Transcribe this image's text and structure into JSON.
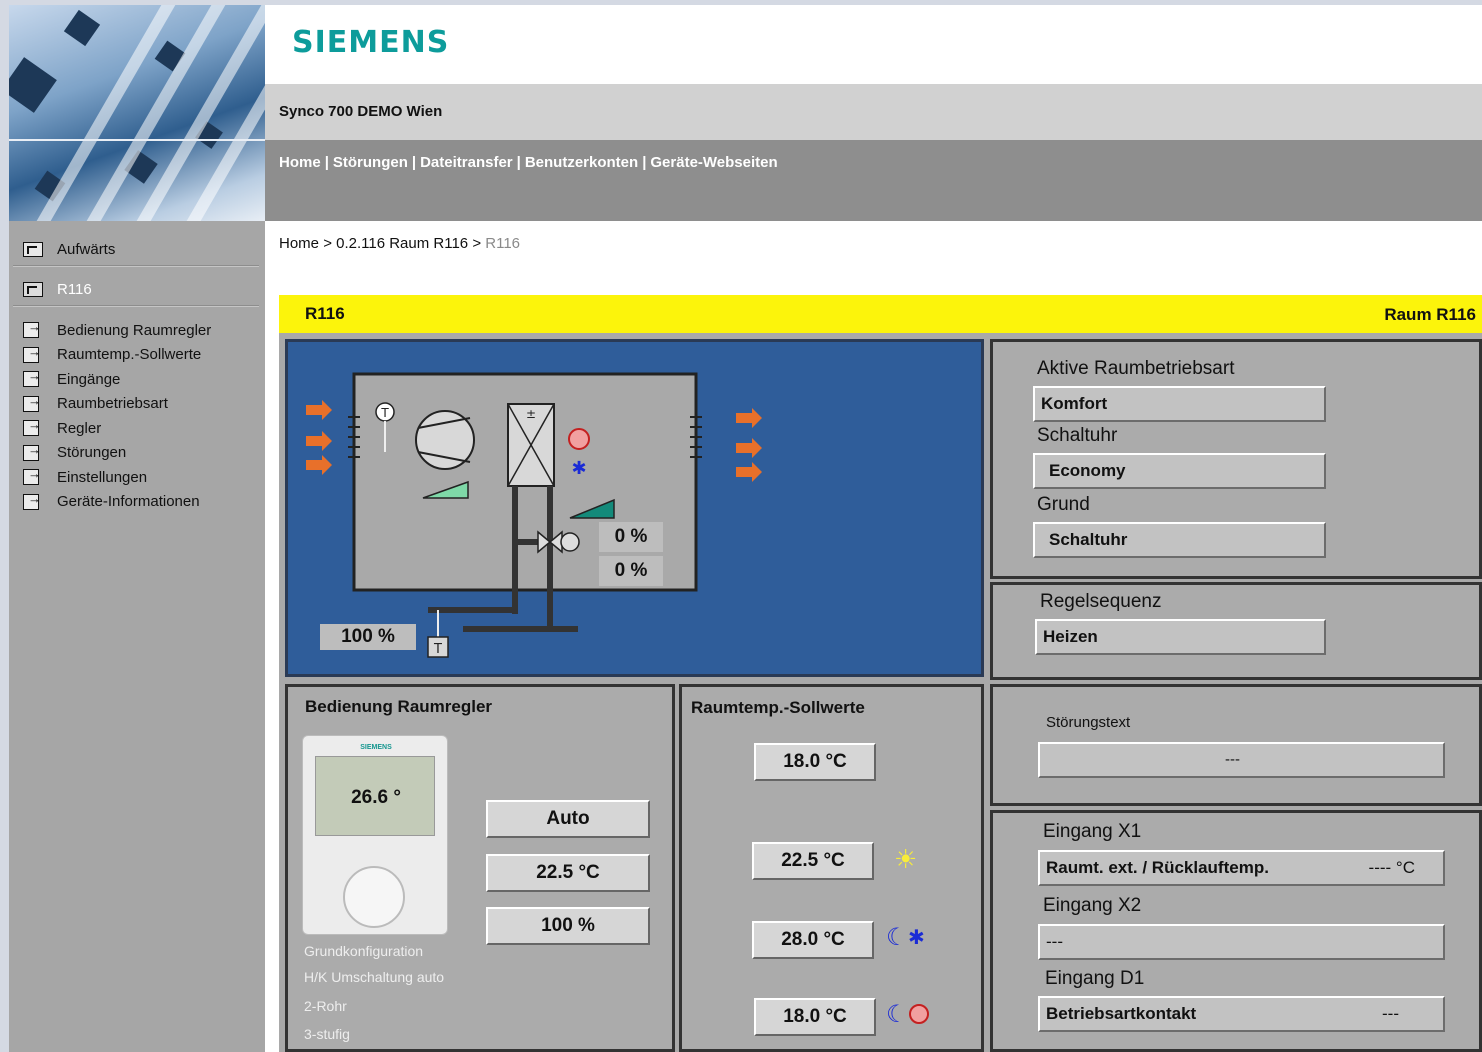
{
  "header": {
    "logo": "SIEMENS",
    "title": "Synco 700 DEMO Wien",
    "nav": [
      {
        "label": "Home"
      },
      {
        "label": "Störungen"
      },
      {
        "label": "Dateitransfer"
      },
      {
        "label": "Benutzerkonten"
      },
      {
        "label": "Geräte-Webseiten"
      }
    ],
    "nav_separator": "|"
  },
  "sidebar": {
    "up": "Aufwärts",
    "current": "R116",
    "items": [
      {
        "label": "Bedienung Raumregler"
      },
      {
        "label": "Raumtemp.-Sollwerte"
      },
      {
        "label": "Eingänge"
      },
      {
        "label": "Raumbetriebsart"
      },
      {
        "label": "Regler"
      },
      {
        "label": "Störungen"
      },
      {
        "label": "Einstellungen"
      },
      {
        "label": "Geräte-Informationen"
      }
    ]
  },
  "breadcrumb": {
    "home": "Home",
    "sep": ">",
    "room": "0.2.116 Raum R116",
    "current": "R116"
  },
  "titlebar": {
    "left": "R116",
    "right": "Raum R116"
  },
  "diagram": {
    "valve_heat": "0 %",
    "valve_cool": "0 %",
    "fan": "100 %",
    "sensor_symbol": "T"
  },
  "mode_panel": {
    "active_label": "Aktive Raumbetriebsart",
    "active_value": "Komfort",
    "timer_label": "Schaltuhr",
    "timer_value": "Economy",
    "reason_label": "Grund",
    "reason_value": "Schaltuhr"
  },
  "sequence_panel": {
    "label": "Regelsequenz",
    "value": "Heizen"
  },
  "controller_panel": {
    "title": "Bedienung Raumregler",
    "device_brand": "SIEMENS",
    "device_temp": "26.6 °",
    "mode": "Auto",
    "setpoint": "22.5 °C",
    "fan": "100 %",
    "config_lines": [
      "Grundkonfiguration",
      "H/K Umschaltung auto",
      "2-Rohr",
      "3-stufig"
    ]
  },
  "setpoints_panel": {
    "title": "Raumtemp.-Sollwerte",
    "values": [
      "18.0 °C",
      "22.5 °C",
      "28.0 °C",
      "18.0 °C"
    ]
  },
  "fault_panel": {
    "label": "Störungstext",
    "value": "---"
  },
  "inputs_panel": {
    "x1_label": "Eingang X1",
    "x1_name": "Raumt. ext. / Rücklauftemp.",
    "x1_value": "---- °C",
    "x2_label": "Eingang X2",
    "x2_value": "---",
    "d1_label": "Eingang D1",
    "d1_name": "Betriebsartkontakt",
    "d1_value": "---"
  },
  "colors": {
    "brand": "#0d9c9b",
    "titlebar": "#fcf40b",
    "diagram_bg": "#2f5d9a",
    "arrows": "#e8702a"
  }
}
